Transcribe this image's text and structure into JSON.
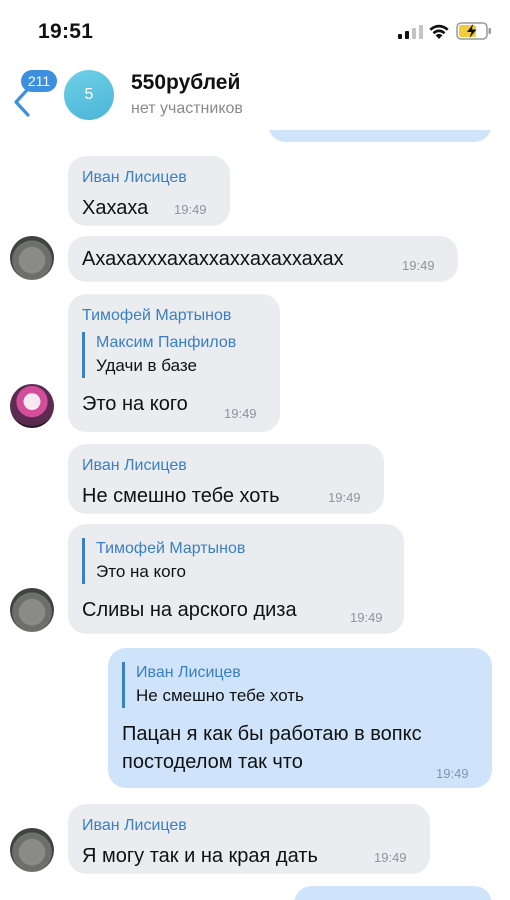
{
  "status_bar": {
    "time": "19:51"
  },
  "header": {
    "back_badge": "211",
    "group_avatar_text": "5",
    "title": "550рублей",
    "subtitle": "нет участников"
  },
  "messages": [
    {
      "sender": "Иван Лисицев",
      "text": "Хахаха",
      "time": "19:49"
    },
    {
      "text": "Ахахаxxхахаxхахxахаxхахах",
      "time": "19:49"
    },
    {
      "sender": "Тимофей Мартынов",
      "reply_name": "Максим Панфилов",
      "reply_text": "Удачи в базе",
      "text": "Это на кого",
      "time": "19:49"
    },
    {
      "sender": "Иван Лисицев",
      "text": "Не смешно тебе хоть",
      "time": "19:49"
    },
    {
      "reply_name": "Тимофей Мартынов",
      "reply_text": "Это на кого",
      "text": "Сливы на арского диза",
      "time": "19:49"
    },
    {
      "reply_name": "Иван Лисицев",
      "reply_text": "Не смешно тебе хоть",
      "text_line1": "Пацан я как бы работаю в вопкс",
      "text_line2": "постоделом так что",
      "time": "19:49"
    },
    {
      "sender": "Иван Лисицев",
      "text": "Я могу так и на края дать",
      "time": "19:49"
    }
  ],
  "colors": {
    "accent": "#3a7fc1",
    "incoming_bubble": "#eaecf0",
    "outgoing_bubble": "#cfe3fa",
    "badge": "#3d8fe0"
  }
}
